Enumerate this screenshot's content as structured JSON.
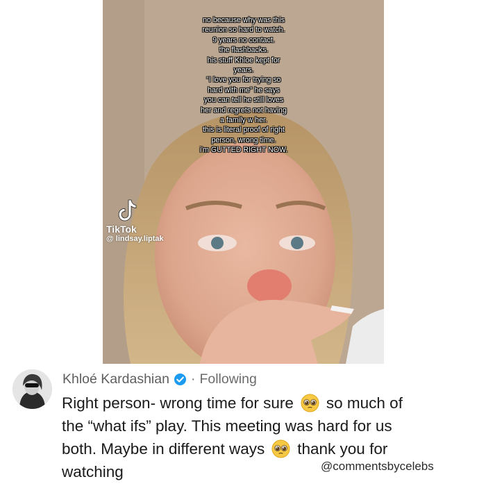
{
  "video": {
    "overlay_lines": [
      "no because why was this",
      "reunion so hard to watch.",
      "9 years no contact.",
      "the flashbacks.",
      "his stuff Khloe kept for",
      "years.",
      "“I love you for trying so",
      "hard with me” he says",
      "you can tell he still loves",
      "her and regrets not having",
      "a family w her.",
      "this is literal proof of right",
      "person, wrong time.",
      "i'm GUTTED RIGHT NOW."
    ],
    "tiktok_label": "TikTok",
    "tiktok_handle": "@ lindsay.liptak",
    "icons": {
      "logo": "tiktok-logo-icon"
    }
  },
  "comment": {
    "author": "Khloé Kardashian",
    "separator": "·",
    "follow_status": "Following",
    "icons": {
      "verified": "verified-badge-icon",
      "emoji": "pleading-face-emoji"
    },
    "colors": {
      "verified": "#1d9bf0",
      "meta_text": "#6b6b6b",
      "body_text": "#1a1a1a"
    },
    "lines": {
      "l1a": "Right person- wrong time for sure",
      "l1b": "so much of",
      "l2": "the “what ifs” play. This meeting was hard for us",
      "l3a": "both. Maybe in different ways",
      "l3b": "thank you for",
      "l4": "watching"
    }
  },
  "watermark": "@commentsbycelebs"
}
